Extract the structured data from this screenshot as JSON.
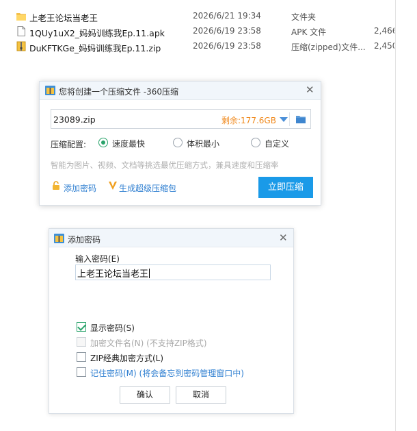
{
  "files": [
    {
      "name": "上老王论坛当老王",
      "date": "2026/6/21 19:34",
      "type": "文件夹",
      "size": "",
      "icon": "folder-icon"
    },
    {
      "name": "1QUy1uX2_妈妈训练我Ep.11.apk",
      "date": "2026/6/19 23:58",
      "type": "APK 文件",
      "size": "2,466",
      "icon": "file-icon"
    },
    {
      "name": "DuKFTKGe_妈妈训练我Ep.11.zip",
      "date": "2026/6/19 23:58",
      "type": "压缩(zipped)文件...",
      "size": "2,450",
      "icon": "zip-file-icon"
    }
  ],
  "zip_dialog": {
    "title": "您将创建一个压缩文件 -360压缩",
    "filename": "23089.zip",
    "free_space": "剩余:177.6GB",
    "config_label": "压缩配置:",
    "options": [
      "速度最快",
      "体积最小",
      "自定义"
    ],
    "selected_option": "速度最快",
    "hint": "智能为图片、视频、文档等挑选最优压缩方式，兼具速度和压缩率",
    "add_password": "添加密码",
    "super_package": "生成超级压缩包",
    "compress_button": "立即压缩",
    "accent_color": "#1a9ae8"
  },
  "password_dialog": {
    "title": "添加密码",
    "input_label": "输入密码(E)",
    "password_value": "上老王论坛当老王",
    "show_password": "显示密码(S)",
    "encrypt_names": "加密文件名(N)  (不支持ZIP格式)",
    "zip_classic": "ZIP经典加密方式(L)",
    "remember": "记住密码(M) (将会备忘到密码管理窗口中)",
    "ok": "确认",
    "cancel": "取消",
    "checks": {
      "show_password": true,
      "encrypt_names": false,
      "zip_classic": false,
      "remember": false
    }
  }
}
